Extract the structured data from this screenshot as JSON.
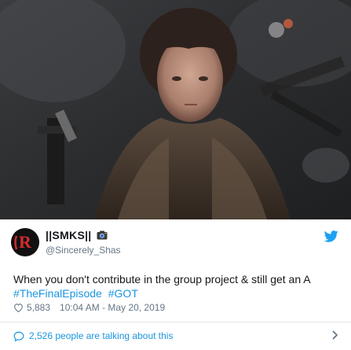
{
  "tweet": {
    "display_name": "||SMKS||",
    "handle": "@Sincerely_Shas",
    "text": "When you don't contribute in the group project & still get an A",
    "hashtags": [
      "#TheFinalEpisode",
      "#GOT"
    ],
    "likes": "5,883",
    "timestamp": "10:04 AM - May 20, 2019",
    "conversation": "2,526 people are talking about this"
  },
  "icons": {
    "avatar": "avatar-logo",
    "name_badge": "camera-icon",
    "brand": "twitter-bird-icon",
    "like": "heart-icon",
    "conversation": "speech-bubble-icon",
    "more": "chevron-right-icon"
  },
  "colors": {
    "link": "#1b95e0",
    "muted": "#657786",
    "text": "#14171a",
    "divider": "#e1e8ed"
  }
}
